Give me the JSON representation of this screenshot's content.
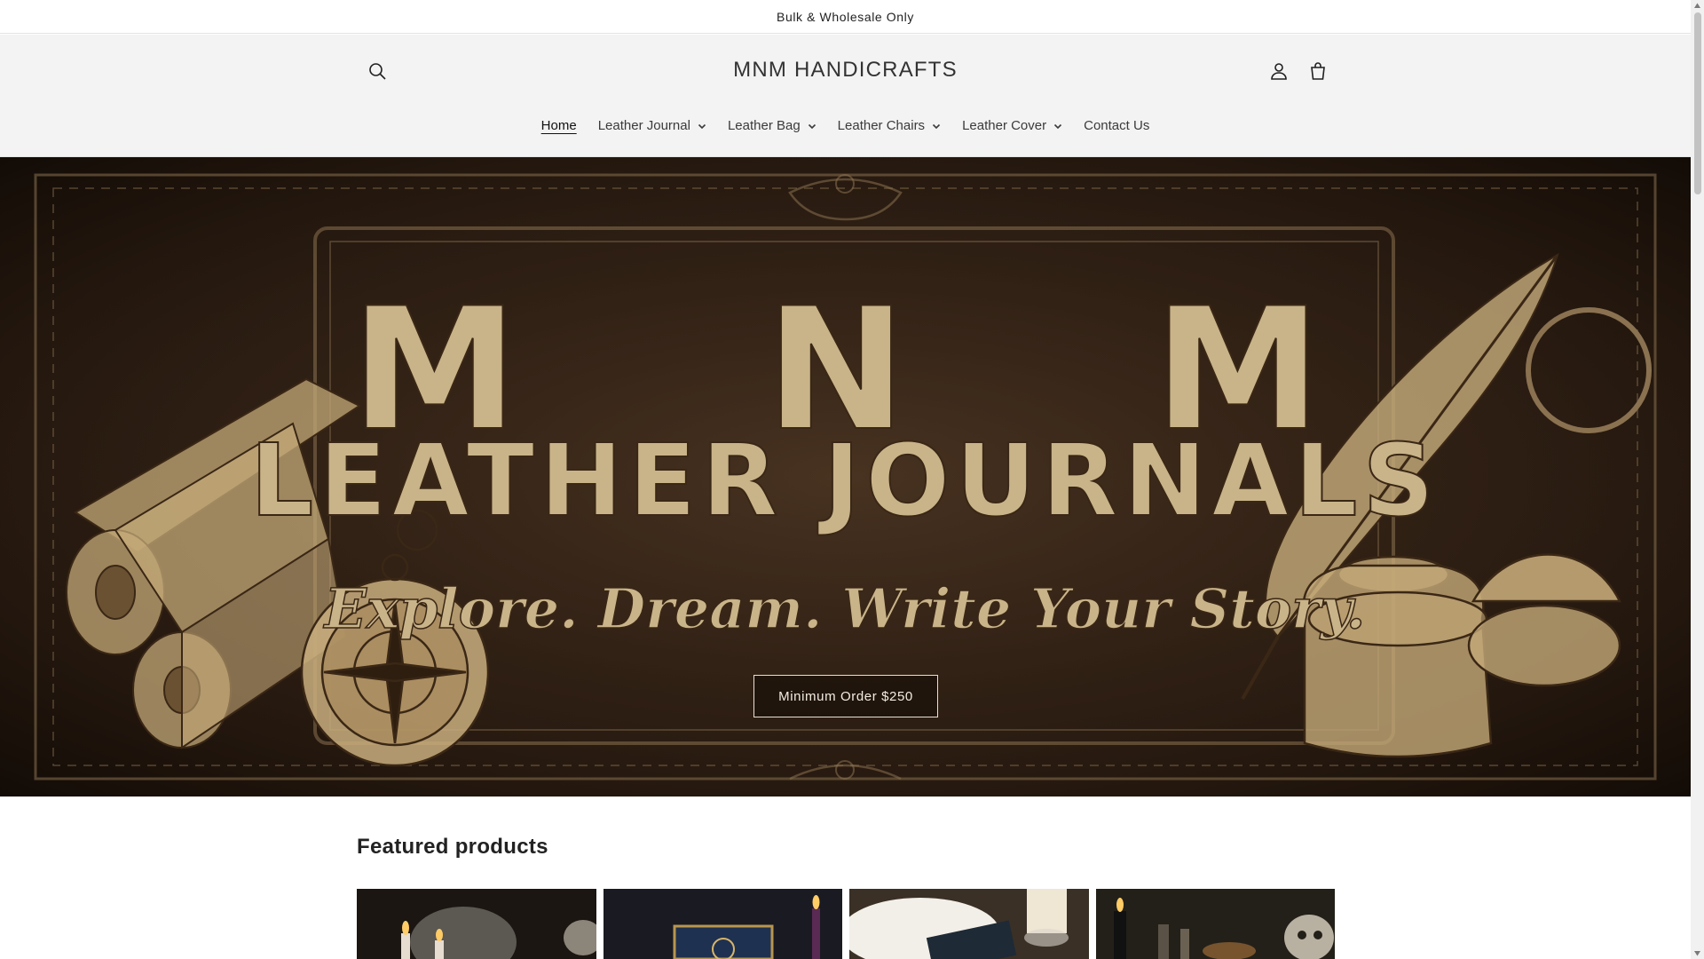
{
  "announcement": {
    "text": "Bulk & Wholesale Only"
  },
  "header": {
    "logo": "MNM HANDICRAFTS",
    "icons": {
      "search": "search-icon",
      "account": "account-icon",
      "cart": "cart-icon"
    }
  },
  "nav": {
    "items": [
      {
        "label": "Home",
        "active": true,
        "dropdown": false
      },
      {
        "label": "Leather Journal",
        "active": false,
        "dropdown": true
      },
      {
        "label": "Leather Bag",
        "active": false,
        "dropdown": true
      },
      {
        "label": "Leather Chairs",
        "active": false,
        "dropdown": true
      },
      {
        "label": "Leather Cover",
        "active": false,
        "dropdown": true
      },
      {
        "label": "Contact Us",
        "active": false,
        "dropdown": false
      }
    ]
  },
  "hero": {
    "banner": {
      "line1": "M   N   M",
      "line2": "LEATHER JOURNALS",
      "tagline": "Explore. Dream. Write Your Story."
    },
    "button_label": "Minimum Order $250"
  },
  "featured": {
    "title": "Featured products"
  },
  "colors": {
    "hero_dark": "#2c1e13",
    "hero_gold": "#c9b48a",
    "header_bg": "#f3f3f3"
  }
}
